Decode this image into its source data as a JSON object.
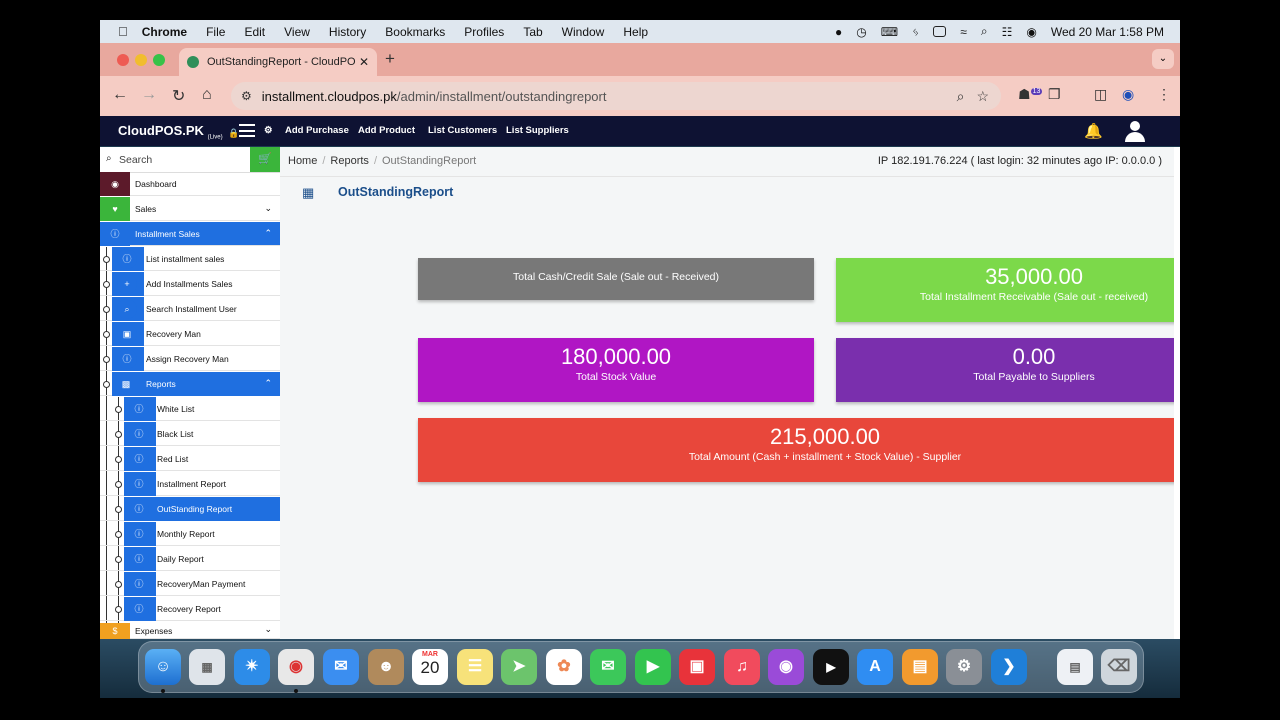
{
  "menubar": {
    "app": "Chrome",
    "items": [
      "File",
      "Edit",
      "View",
      "History",
      "Bookmarks",
      "Profiles",
      "Tab",
      "Window",
      "Help"
    ],
    "clock": "Wed 20 Mar  1:58 PM"
  },
  "browser": {
    "tab_title": "OutStandingReport - CloudPO",
    "url_host": "installment.cloudpos.pk",
    "url_path": "/admin/installment/outstandingreport",
    "extension_badge": "13"
  },
  "header": {
    "brand": "CloudPOS.PK",
    "brand_sub": "(Live)",
    "links": [
      "Add Purchase",
      "Add Product",
      "List Customers",
      "List Suppliers"
    ]
  },
  "sidebar": {
    "search_placeholder": "Search",
    "dashboard": "Dashboard",
    "sales": "Sales",
    "installment_sales": "Installment Sales",
    "installment_items": [
      "List installment sales",
      "Add Installments Sales",
      "Search Installment User",
      "Recovery Man",
      "Assign Recovery Man"
    ],
    "reports": "Reports",
    "report_items": [
      "White List",
      "Black List",
      "Red List",
      "Installment Report",
      "OutStanding Report",
      "Monthly Report",
      "Daily Report",
      "RecoveryMan Payment",
      "Recovery Report"
    ],
    "expenses": "Expenses",
    "expenses_icon_text": "$"
  },
  "breadcrumb": {
    "home": "Home",
    "reports": "Reports",
    "current": "OutStandingReport"
  },
  "ip_info": "IP 182.191.76.224 ( last login: 32 minutes ago IP: 0.0.0.0 )",
  "page_title": "OutStandingReport",
  "cards": {
    "cash_credit": {
      "amount": "",
      "caption": "Total Cash/Credit Sale (Sale out - Received)",
      "color": "#787878"
    },
    "installment_receivable": {
      "amount": "35,000.00",
      "caption": "Total Installment Receivable (Sale out - received)",
      "color": "#7cd94a"
    },
    "stock_value": {
      "amount": "180,000.00",
      "caption": "Total Stock Value",
      "color": "#b016c4"
    },
    "payable_suppliers": {
      "amount": "0.00",
      "caption": "Total Payable to Suppliers",
      "color": "#7a2fad"
    },
    "total_amount": {
      "amount": "215,000.00",
      "caption": "Total Amount (Cash + installment + Stock Value) - Supplier",
      "color": "#e8473b"
    }
  },
  "dock": {
    "calendar_month": "MAR",
    "calendar_day": "20"
  }
}
